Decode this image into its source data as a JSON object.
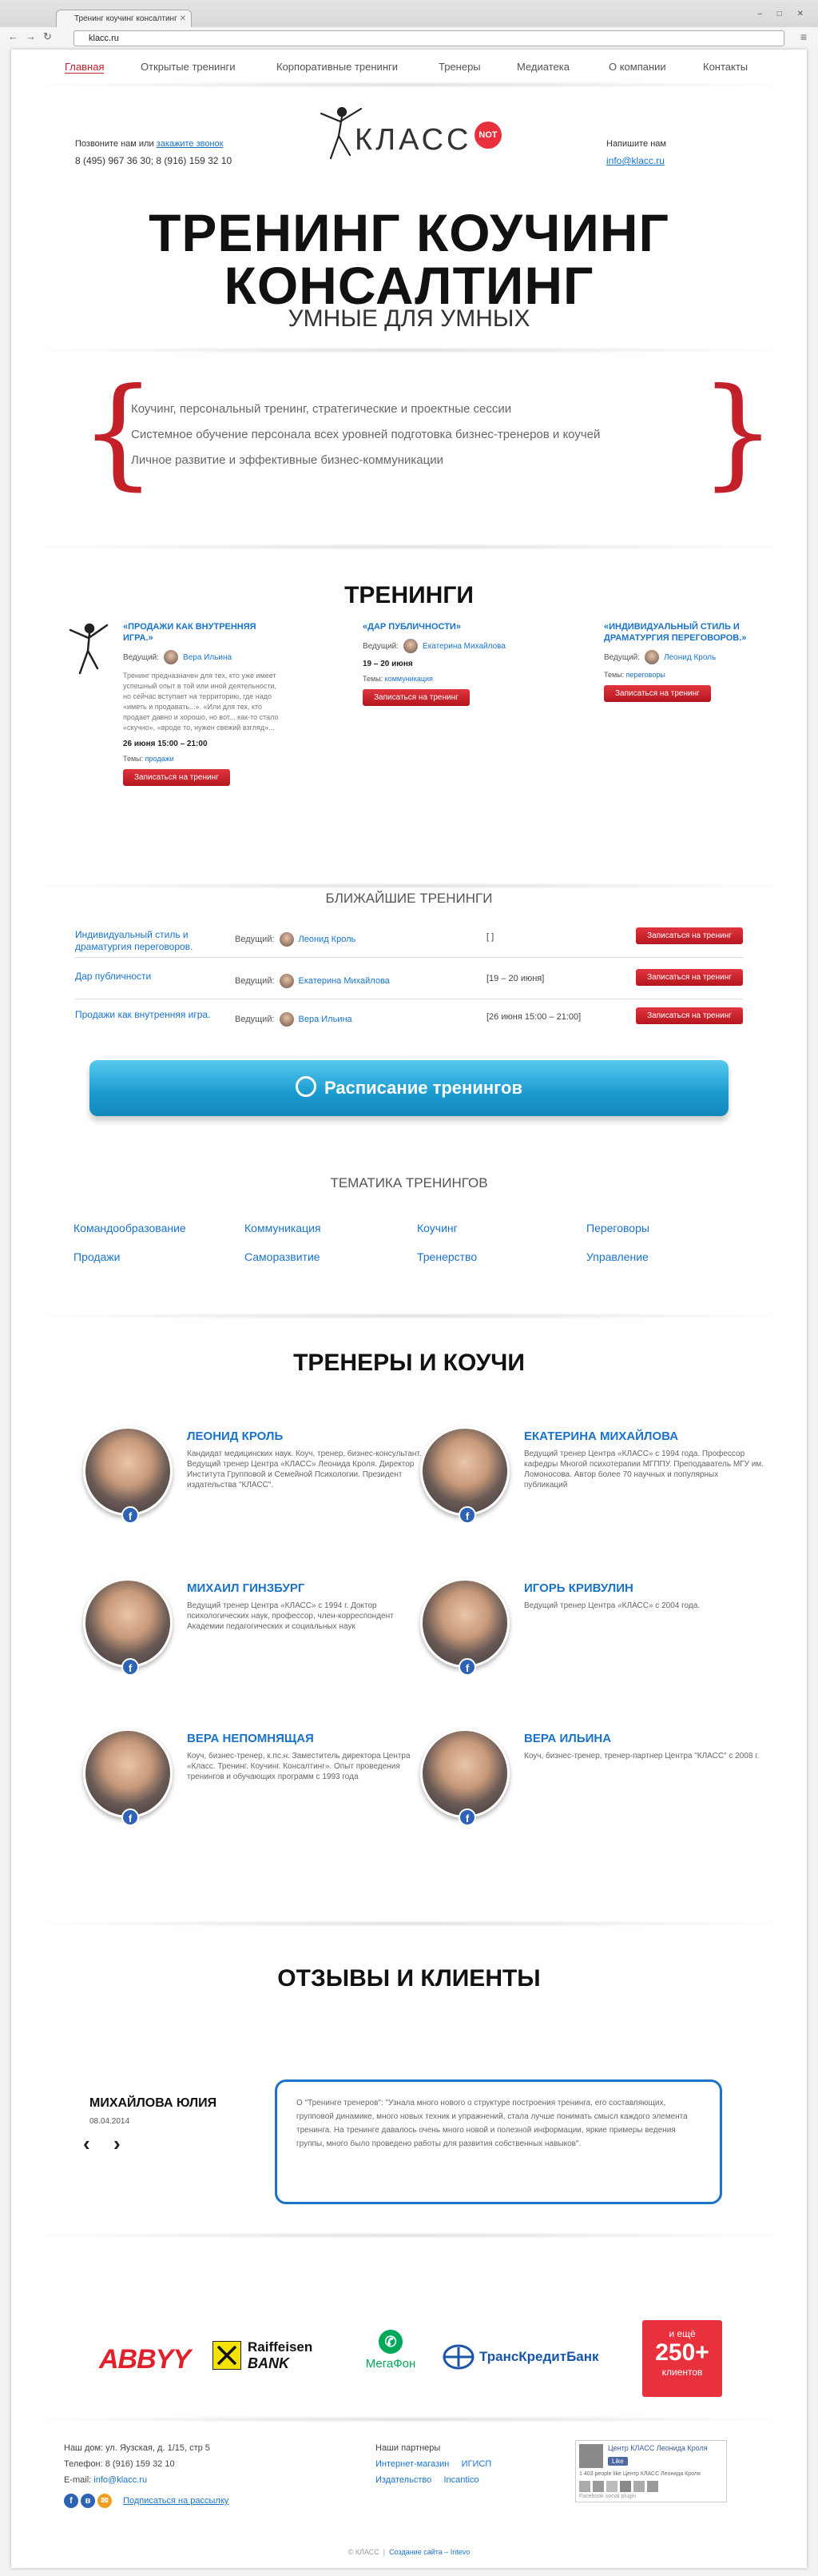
{
  "browser": {
    "tab_title": "Тренинг коучинг консалтинг",
    "url": "klacc.ru"
  },
  "nav": [
    "Главная",
    "Открытые тренинги",
    "Корпоративные тренинги",
    "Тренеры",
    "Медиатека",
    "О компании",
    "Контакты"
  ],
  "header": {
    "call_text": "Позвоните нам или",
    "call_link": "закажите звонок",
    "phones": "8 (495) 967 36 30; 8 (916) 159 32 10",
    "logo_text": "КЛАСС",
    "logo_badge": "NOT",
    "write_label": "Напишите нам",
    "email": "info@klacc.ru"
  },
  "hero": {
    "line1": "ТРЕНИНГ КОУЧИНГ",
    "line2": "КОНСАЛТИНГ",
    "subtitle": "УМНЫЕ ДЛЯ УМНЫХ"
  },
  "services": [
    "Коучинг, персональный тренинг, стратегические и проектные сессии",
    "Системное обучение персонала всех уровней подготовка бизнес-тренеров и коучей",
    "Личное развитие и эффективные бизнес-коммуникации"
  ],
  "trainings": {
    "title": "ТРЕНИНГИ",
    "lead_label": "Ведущий:",
    "topic_label": "Темы:",
    "button": "Записаться на тренинг",
    "cards": [
      {
        "title": "«ПРОДАЖИ КАК ВНУТРЕННЯЯ ИГРА.»",
        "leader": "Вера Ильина",
        "desc": "Тренинг предназначен для тех, кто уже имеет успешный опыт в той или иной деятельности, но сейчас вступает на территорию, где надо «иметь и продавать...». «Или для тех, кто продает давно и хорошо, но вот... как-то стало «скучно», «вроде то, нужен свежий взгляд»...",
        "date": "26 июня 15:00 – 21:00",
        "topic": "продажи"
      },
      {
        "title": "«ДАР ПУБЛИЧНОСТИ»",
        "leader": "Екатерина Михайлова",
        "date": "19 – 20 июня",
        "topic": "коммуникация"
      },
      {
        "title": "«ИНДИВИДУАЛЬНЫЙ СТИЛЬ И ДРАМАТУРГИЯ ПЕРЕГОВОРОВ.»",
        "leader": "Леонид Кроль",
        "topic": "переговоры"
      }
    ]
  },
  "upcoming": {
    "title": "БЛИЖАЙШИЕ ТРЕНИНГИ",
    "lead_label": "Ведущий:",
    "rows": [
      {
        "name": "Индивидуальный стиль и драматургия переговоров.",
        "leader": "Леонид Кроль",
        "date": "[ ]"
      },
      {
        "name": "Дар публичности",
        "leader": "Екатерина Михайлова",
        "date": "[19 – 20 июня]"
      },
      {
        "name": "Продажи как внутренняя игра.",
        "leader": "Вера Ильина",
        "date": "[26 июня 15:00 – 21:00]"
      }
    ],
    "button": "Записаться на тренинг"
  },
  "schedule_button": "Расписание тренингов",
  "topics": {
    "title": "ТЕМАТИКА ТРЕНИНГОВ",
    "items": [
      "Командообразование",
      "Коммуникация",
      "Коучинг",
      "Переговоры",
      "Продажи",
      "Саморазвитие",
      "Тренерство",
      "Управление"
    ]
  },
  "trainers": {
    "title": "ТРЕНЕРЫ И КОУЧИ",
    "fb": "f",
    "items": [
      {
        "name": "ЛЕОНИД КРОЛЬ",
        "bio": "Кандидат медицинских наук. Коуч, тренер, бизнес-консультант. Ведущий тренер Центра «КЛАСС» Леонида Кроля. Директор Института Групповой и Семейной Психологии. Президент издательства \"КЛАСС\"."
      },
      {
        "name": "ЕКАТЕРИНА МИХАЙЛОВА",
        "bio": "Ведущий тренер Центра «КЛАСС» с 1994 года. Профессор кафедры Многой психотерапии МГППУ. Преподаватель МГУ им. Ломоносова. Автор более 70 научных и популярных публикаций"
      },
      {
        "name": "МИХАИЛ ГИНЗБУРГ",
        "bio": "Ведущий тренер Центра «КЛАСС» с 1994 г. Доктор психологических наук, профессор, член-корреспондент Академии педагогических и социальных наук"
      },
      {
        "name": "ИГОРЬ КРИВУЛИН",
        "bio": "Ведущий тренер Центра «КЛАСС» с 2004 года."
      },
      {
        "name": "ВЕРА НЕПОМНЯЩАЯ",
        "bio": "Коуч, бизнес-тренер, к.пс.н. Заместитель директора Центра «Класс. Тренинг. Коучинг. Консалтинг». Опыт проведения тренингов и обучающих программ с 1993 года"
      },
      {
        "name": "ВЕРА ИЛЬИНА",
        "bio": "Коуч, бизнес-тренер, тренер-партнер Центра \"КЛАСС\" с 2008 г."
      }
    ]
  },
  "reviews": {
    "title": "ОТЗЫВЫ И КЛИЕНТЫ",
    "name": "МИХАЙЛОВА ЮЛИЯ",
    "date": "08.04.2014",
    "text": "О \"Тренинге тренеров\": \"Узнала много нового о структуре построения тренинга, его составляющих, групповой динамике, много новых техник и упражнений, стала лучше понимать смысл каждого элемента тренинга. На тренинге давалось очень много новой и полезной информации, яркие примеры ведения группы, много было проведено работы для развития собственных навыков\"."
  },
  "clients": {
    "abbyy": "ABBYY",
    "raif1": "Raiffeisen",
    "raif2": "BANK",
    "megafon": "МегаФон",
    "tkb": "ТрансКредитБанк",
    "more_line1": "и ещё",
    "more_num": "250+",
    "more_line2": "клиентов"
  },
  "footer": {
    "address": "Наш дом: ул. Яузская, д. 1/15, стр 5",
    "phone": "Телефон: 8 (916) 159 32 10",
    "email_label": "E-mail:",
    "email": "info@klacc.ru",
    "subscribe": "Подписаться на рассылку",
    "partners_title": "Наши партнеры",
    "partners": [
      "Интернет-магазин",
      "ИГИСП",
      "Издательство",
      "Incantico"
    ],
    "fb_page": "Центр КЛАСС Леонида Кроля",
    "fb_like": "Like",
    "fb_count": "1 403 people like Центр КЛАСС Леонида Кроля",
    "fb_plugin": "Facebook social plugin",
    "copyright": "© КЛАСС",
    "made_by": "Создание сайта – Intevo"
  },
  "colors": {
    "accent_red": "#c4202a",
    "link_blue": "#1a73c8",
    "button_cyan": "#1a9ad0"
  }
}
